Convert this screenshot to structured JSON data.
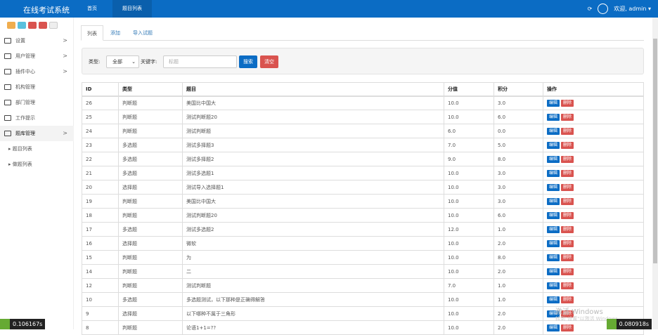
{
  "header": {
    "title": "在线考试系统",
    "nav": [
      "首页",
      "题目列表"
    ],
    "welcome": "欢迎, admin ▾"
  },
  "sidebar": {
    "quick_colors": [
      "#f0ad4e",
      "#5bc0de",
      "#d9534f",
      "#d9534f",
      "#eeeeee"
    ],
    "items": [
      {
        "label": "设置",
        "arrow": ">"
      },
      {
        "label": "用户管理",
        "arrow": ">"
      },
      {
        "label": "插件中心",
        "arrow": ">"
      },
      {
        "label": "机构管理"
      },
      {
        "label": "部门管理"
      },
      {
        "label": "工作提示"
      },
      {
        "label": "题库管理",
        "arrow": ">"
      }
    ],
    "subitems": [
      "题目列表",
      "做题列表"
    ]
  },
  "tabs": [
    "列表",
    "添加",
    "导入试题"
  ],
  "search": {
    "type_label": "类型:",
    "type_value": "全部",
    "keyword_label": "关键字:",
    "keyword_placeholder": "标题",
    "search_btn": "搜索",
    "clear_btn": "清空"
  },
  "table": {
    "headers": [
      "ID",
      "类型",
      "题目",
      "分值",
      "积分",
      "操作"
    ],
    "edit": "编辑",
    "delete": "删除",
    "rows": [
      [
        "26",
        "判断题",
        "美国比中国大",
        "10.0",
        "3.0"
      ],
      [
        "25",
        "判断题",
        "测试判断题20",
        "10.0",
        "6.0"
      ],
      [
        "24",
        "判断题",
        "测试判断题",
        "6.0",
        "0.0"
      ],
      [
        "23",
        "多选题",
        "测试多择题3",
        "7.0",
        "5.0"
      ],
      [
        "22",
        "多选题",
        "测试多择题2",
        "9.0",
        "8.0"
      ],
      [
        "21",
        "多选题",
        "测试多选题1",
        "10.0",
        "3.0"
      ],
      [
        "20",
        "选择题",
        "测试导入选择题1",
        "10.0",
        "3.0"
      ],
      [
        "19",
        "判断题",
        "美国比中国大",
        "10.0",
        "3.0"
      ],
      [
        "18",
        "判断题",
        "测试判断题20",
        "10.0",
        "6.0"
      ],
      [
        "17",
        "多选题",
        "测试多选题2",
        "12.0",
        "1.0"
      ],
      [
        "16",
        "选择题",
        "微软",
        "10.0",
        "2.0"
      ],
      [
        "15",
        "判断题",
        "为",
        "10.0",
        "8.0"
      ],
      [
        "14",
        "判断题",
        "二",
        "10.0",
        "2.0"
      ],
      [
        "12",
        "判断题",
        "测试判断题",
        "7.0",
        "1.0"
      ],
      [
        "10",
        "多选题",
        "多选题测试，以下那种是正确得解答",
        "10.0",
        "1.0"
      ],
      [
        "9",
        "选择题",
        "以下哪种不属于三角形",
        "10.0",
        "2.0"
      ],
      [
        "8",
        "判断题",
        "论语1+1=??",
        "10.0",
        "2.0"
      ]
    ]
  },
  "timers": {
    "left": "0.106167s",
    "right": "0.080918s"
  },
  "watermark": {
    "line1": "激活 Windows",
    "line2": "转到\"设置\"以激活 Windows。"
  }
}
